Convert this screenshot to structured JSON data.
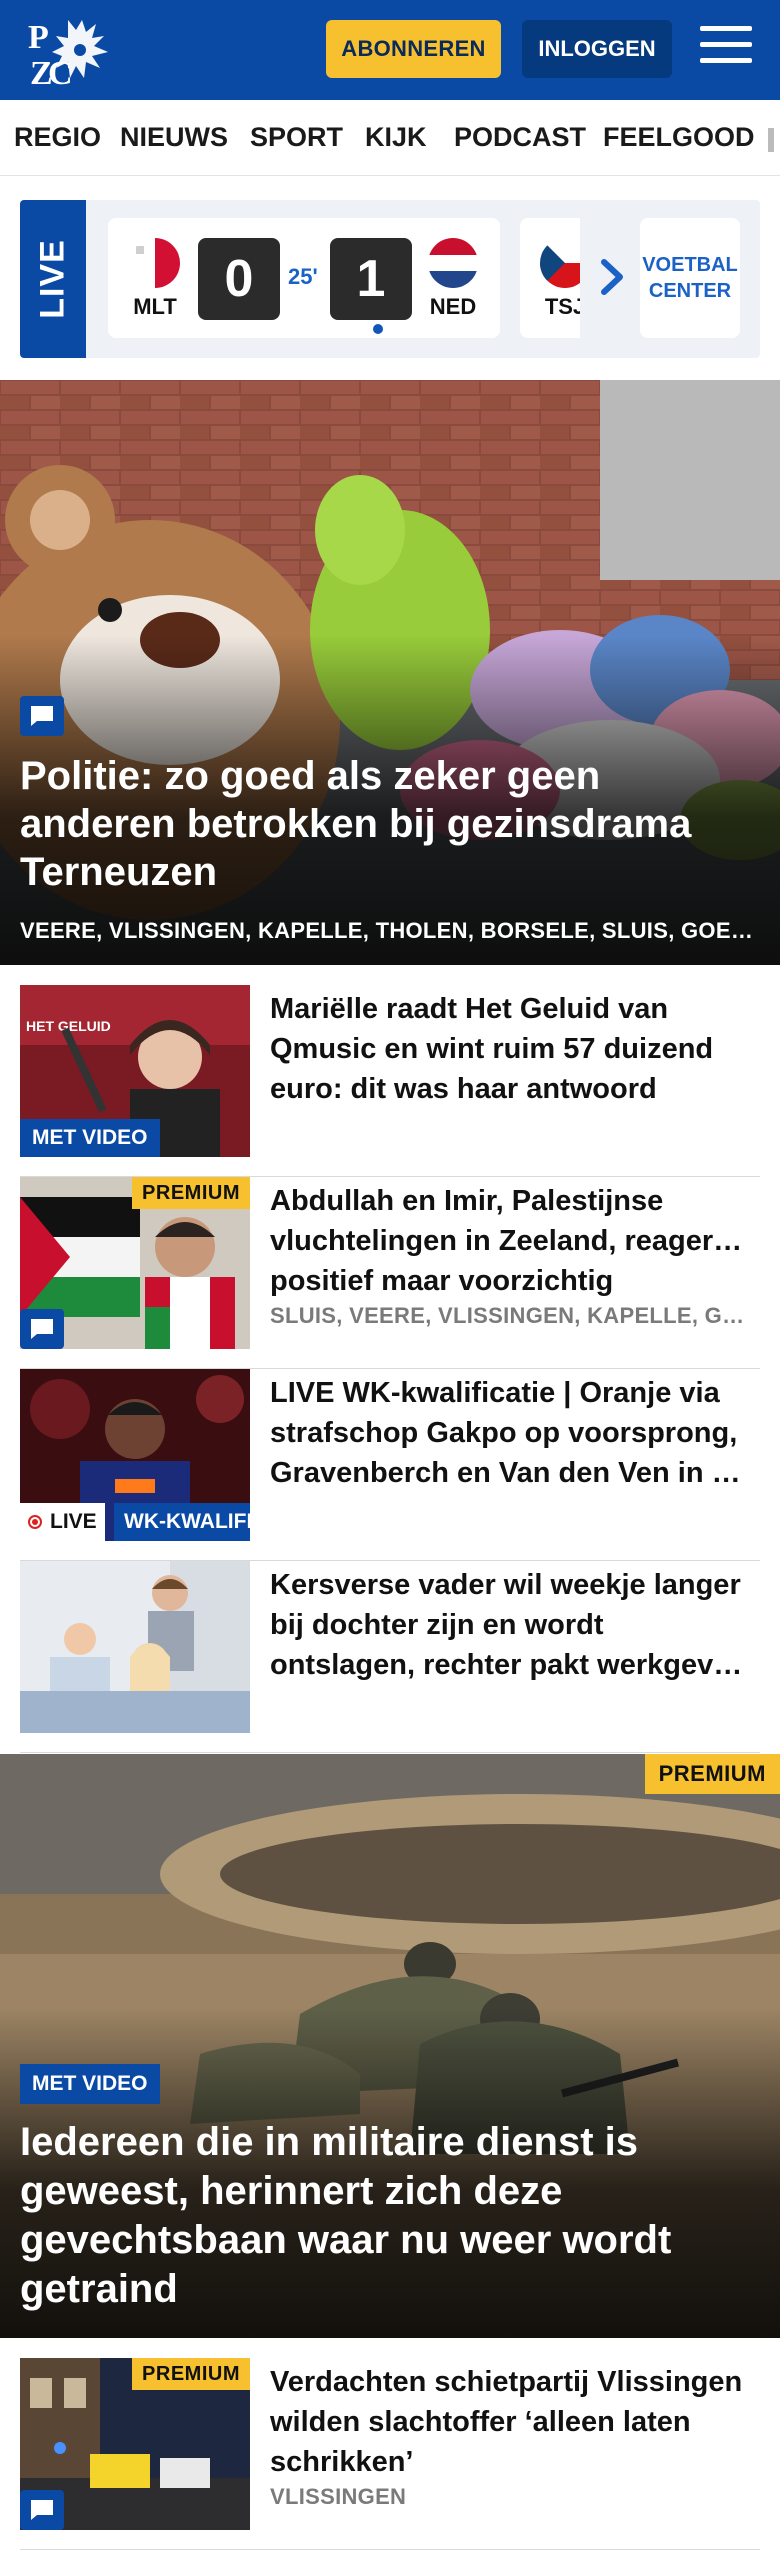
{
  "header": {
    "brand": "PZC",
    "subscribe_label": "ABONNEREN",
    "login_label": "INLOGGEN",
    "menu_icon": "hamburger-menu-icon",
    "colors": {
      "brand_blue": "#0a4aa5",
      "accent_yellow": "#f6c02f"
    }
  },
  "nav": {
    "items": [
      {
        "label": "REGIO"
      },
      {
        "label": "NIEUWS"
      },
      {
        "label": "SPORT"
      },
      {
        "label": "KIJK"
      },
      {
        "label": "PODCAST"
      },
      {
        "label": "FEELGOOD"
      }
    ]
  },
  "live_widget": {
    "tab_label": "LIVE",
    "match": {
      "home_code": "MLT",
      "home_score": "0",
      "minute": "25'",
      "away_score": "1",
      "away_code": "NED"
    },
    "next_match_code": "TSJ",
    "center_label_line1": "VOETBAL",
    "center_label_line2": "CENTER"
  },
  "hero": {
    "title": "Politie: zo goed als zeker geen anderen betrokken bij gezinsdrama Terneuzen",
    "tags": "VEERE, VLISSINGEN, KAPELLE, THOLEN, BORSELE, SLUIS, GOES, TERNEUZEN",
    "icon": "comment-icon"
  },
  "articles": [
    {
      "title": "Mariëlle raadt Het Geluid van Qmusic en wint ruim 57 duizend euro: dit was haar antwoord",
      "video_label": "MET VIDEO",
      "thumb_caption": "HET GELUID"
    },
    {
      "title": "Abdullah en Imir, Palestijnse vluchtelingen in Zeeland, reageren positief maar voorzichtig",
      "premium_label": "PREMIUM",
      "tags": "SLUIS, VEERE, VLISSINGEN, KAPELLE, GOES"
    },
    {
      "title": "LIVE WK-kwalificatie | Oranje via strafschop Gakpo op voorsprong, Gravenberch en Van den Ven in de basis",
      "live_label": "LIVE",
      "category_label": "WK-KWALIFICATIE"
    },
    {
      "title": "Kersverse vader wil weekje langer bij dochter zijn en wordt ontslagen, rechter pakt werkgever aan"
    }
  ],
  "hero2": {
    "premium_label": "PREMIUM",
    "video_label": "MET VIDEO",
    "title": "Iedereen die in militaire dienst is geweest, herinnert zich deze gevechtsbaan waar nu weer wordt getraind"
  },
  "article_bottom": {
    "title": "Verdachten schietpartij Vlissingen wilden slachtoffer ‘alleen laten schrikken’",
    "premium_label": "PREMIUM",
    "tags": "VLISSINGEN"
  }
}
